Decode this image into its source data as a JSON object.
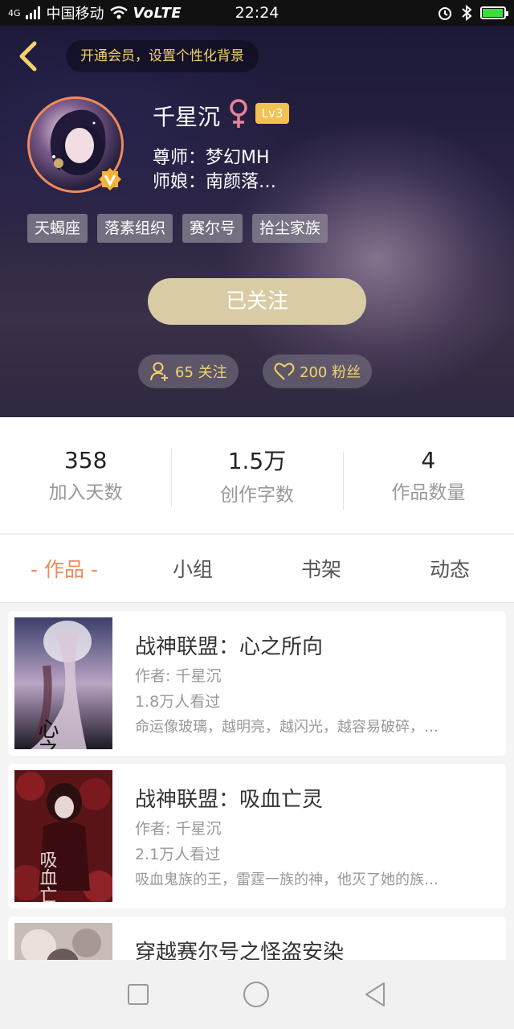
{
  "status_bar": {
    "network": "4G",
    "carrier": "中国移动",
    "volte": "VoLTE",
    "time": "22:24"
  },
  "header": {
    "vip_banner": "开通会员，设置个性化背景",
    "username": "千星沉",
    "gender": "female",
    "level": "Lv3",
    "mentor_line": "尊师：梦幻MH",
    "mentor_wife_line": "师娘：南颜落…",
    "tags": [
      "天蝎座",
      "落素组织",
      "赛尔号",
      "拾尘家族"
    ],
    "follow_button": "已关注",
    "following_count": "65 关注",
    "fans_count": "200 粉丝"
  },
  "stats": [
    {
      "value": "358",
      "label": "加入天数"
    },
    {
      "value": "1.5万",
      "label": "创作字数"
    },
    {
      "value": "4",
      "label": "作品数量"
    }
  ],
  "tabs": [
    {
      "label": "- 作品 -",
      "active": true
    },
    {
      "label": "小组",
      "active": false
    },
    {
      "label": "书架",
      "active": false
    },
    {
      "label": "动态",
      "active": false
    }
  ],
  "books": [
    {
      "title": "战神联盟：心之所向",
      "author": "作者: 千星沉",
      "views": "1.8万人看过",
      "description": "命运像玻璃，越明亮，越闪光，越容易破碎，…",
      "cover_text": "心之所向"
    },
    {
      "title": "战神联盟：吸血亡灵",
      "author": "作者: 千星沉",
      "views": "2.1万人看过",
      "description": "吸血鬼族的王，雷霆一族的神，他灭了她的族…",
      "cover_text": "吸血亡灵"
    },
    {
      "title": "穿越赛尔号之怪盗安染",
      "author": "",
      "views": "",
      "description": ""
    }
  ],
  "colors": {
    "accent": "#f08a5a",
    "gold": "#f2d36b",
    "follow_button": "#d9cca4",
    "level_badge": "#f2c14e"
  },
  "icons": {
    "back": "chevron-left-icon",
    "gender": "female-icon",
    "vip": "v-badge-icon",
    "following": "add-user-icon",
    "fans": "heart-icon",
    "nav_recent": "square-icon",
    "nav_home": "circle-icon",
    "nav_back": "triangle-back-icon"
  }
}
